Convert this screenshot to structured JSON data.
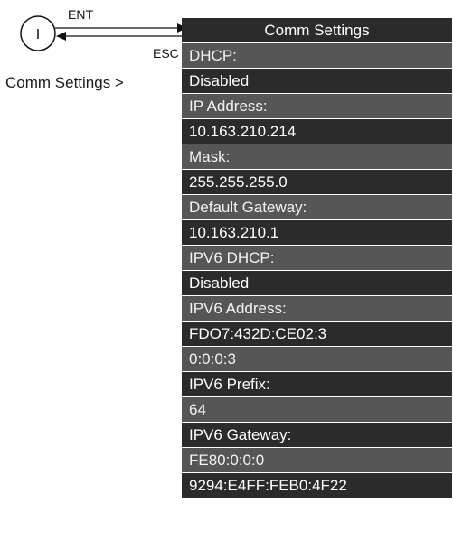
{
  "nav": {
    "enter_key": "ENT",
    "escape_key": "ESC",
    "indicator_symbol": "I",
    "menu_path": "Comm Settings >"
  },
  "panel": {
    "title": "Comm Settings",
    "rows": [
      {
        "text": "DHCP:",
        "kind": "label"
      },
      {
        "text": "Disabled",
        "kind": "value"
      },
      {
        "text": "IP Address:",
        "kind": "label"
      },
      {
        "text": "10.163.210.214",
        "kind": "value"
      },
      {
        "text": "Mask:",
        "kind": "label"
      },
      {
        "text": "255.255.255.0",
        "kind": "value"
      },
      {
        "text": "Default Gateway:",
        "kind": "label"
      },
      {
        "text": "10.163.210.1",
        "kind": "value"
      },
      {
        "text": "IPV6 DHCP:",
        "kind": "label"
      },
      {
        "text": "Disabled",
        "kind": "value"
      },
      {
        "text": "IPV6 Address:",
        "kind": "label"
      },
      {
        "text": "FDO7:432D:CE02:3",
        "kind": "value"
      },
      {
        "text": "0:0:0:3",
        "kind": "label"
      },
      {
        "text": "IPV6 Prefix:",
        "kind": "value"
      },
      {
        "text": "64",
        "kind": "label"
      },
      {
        "text": "IPV6 Gateway:",
        "kind": "value"
      },
      {
        "text": "FE80:0:0:0",
        "kind": "label"
      },
      {
        "text": "9294:E4FF:FEB0:4F22",
        "kind": "value"
      }
    ]
  },
  "colors": {
    "header_background": "#2b2b2b",
    "label_row_background": "#565656",
    "value_row_background": "#2b2b2b",
    "row_text": "#ffffff"
  }
}
